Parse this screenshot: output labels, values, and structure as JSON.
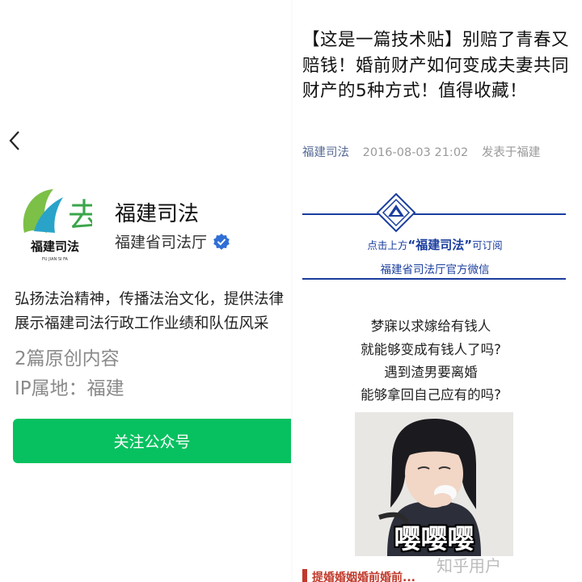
{
  "profile": {
    "logo_text": "福建司法",
    "logo_small_text": "FU JIAN SI FA",
    "name": "福建司法",
    "org": "福建省司法厅",
    "desc_line1": "弘扬法治精神，传播法治文化，提供法律",
    "desc_line2": "展示福建司法行政工作业绩和队伍风采",
    "original_count": "2篇原创内容",
    "ip_location": "IP属地：福建",
    "follow_label": "关注公众号"
  },
  "article": {
    "title": "【这是一篇技术贴】别赔了青春又赔钱！婚前财产如何变成夫妻共同财产的5种方式！值得收藏！",
    "source": "福建司法",
    "datetime": "2016-08-03 21:02",
    "published_in": "发表于福建",
    "banner_prefix": "点击上方",
    "banner_name": "“福建司法”",
    "banner_suffix": "可订阅",
    "banner_sub": "福建省司法厅官方微信",
    "poem": [
      "梦寐以求嫁给有钱人",
      "就能够变成有钱人了吗?",
      "遇到渣男要离婚",
      "能够拿回自己应有的吗?"
    ],
    "photo_caption": "嘤嘤嘤",
    "section_red": "提婚婚姻婚前婚前..."
  },
  "watermark": "知乎用户",
  "colors": {
    "follow_green": "#07c160",
    "banner_blue": "#1a3d9e",
    "link_blue": "#576b95",
    "verified_blue": "#2f6fd6"
  }
}
